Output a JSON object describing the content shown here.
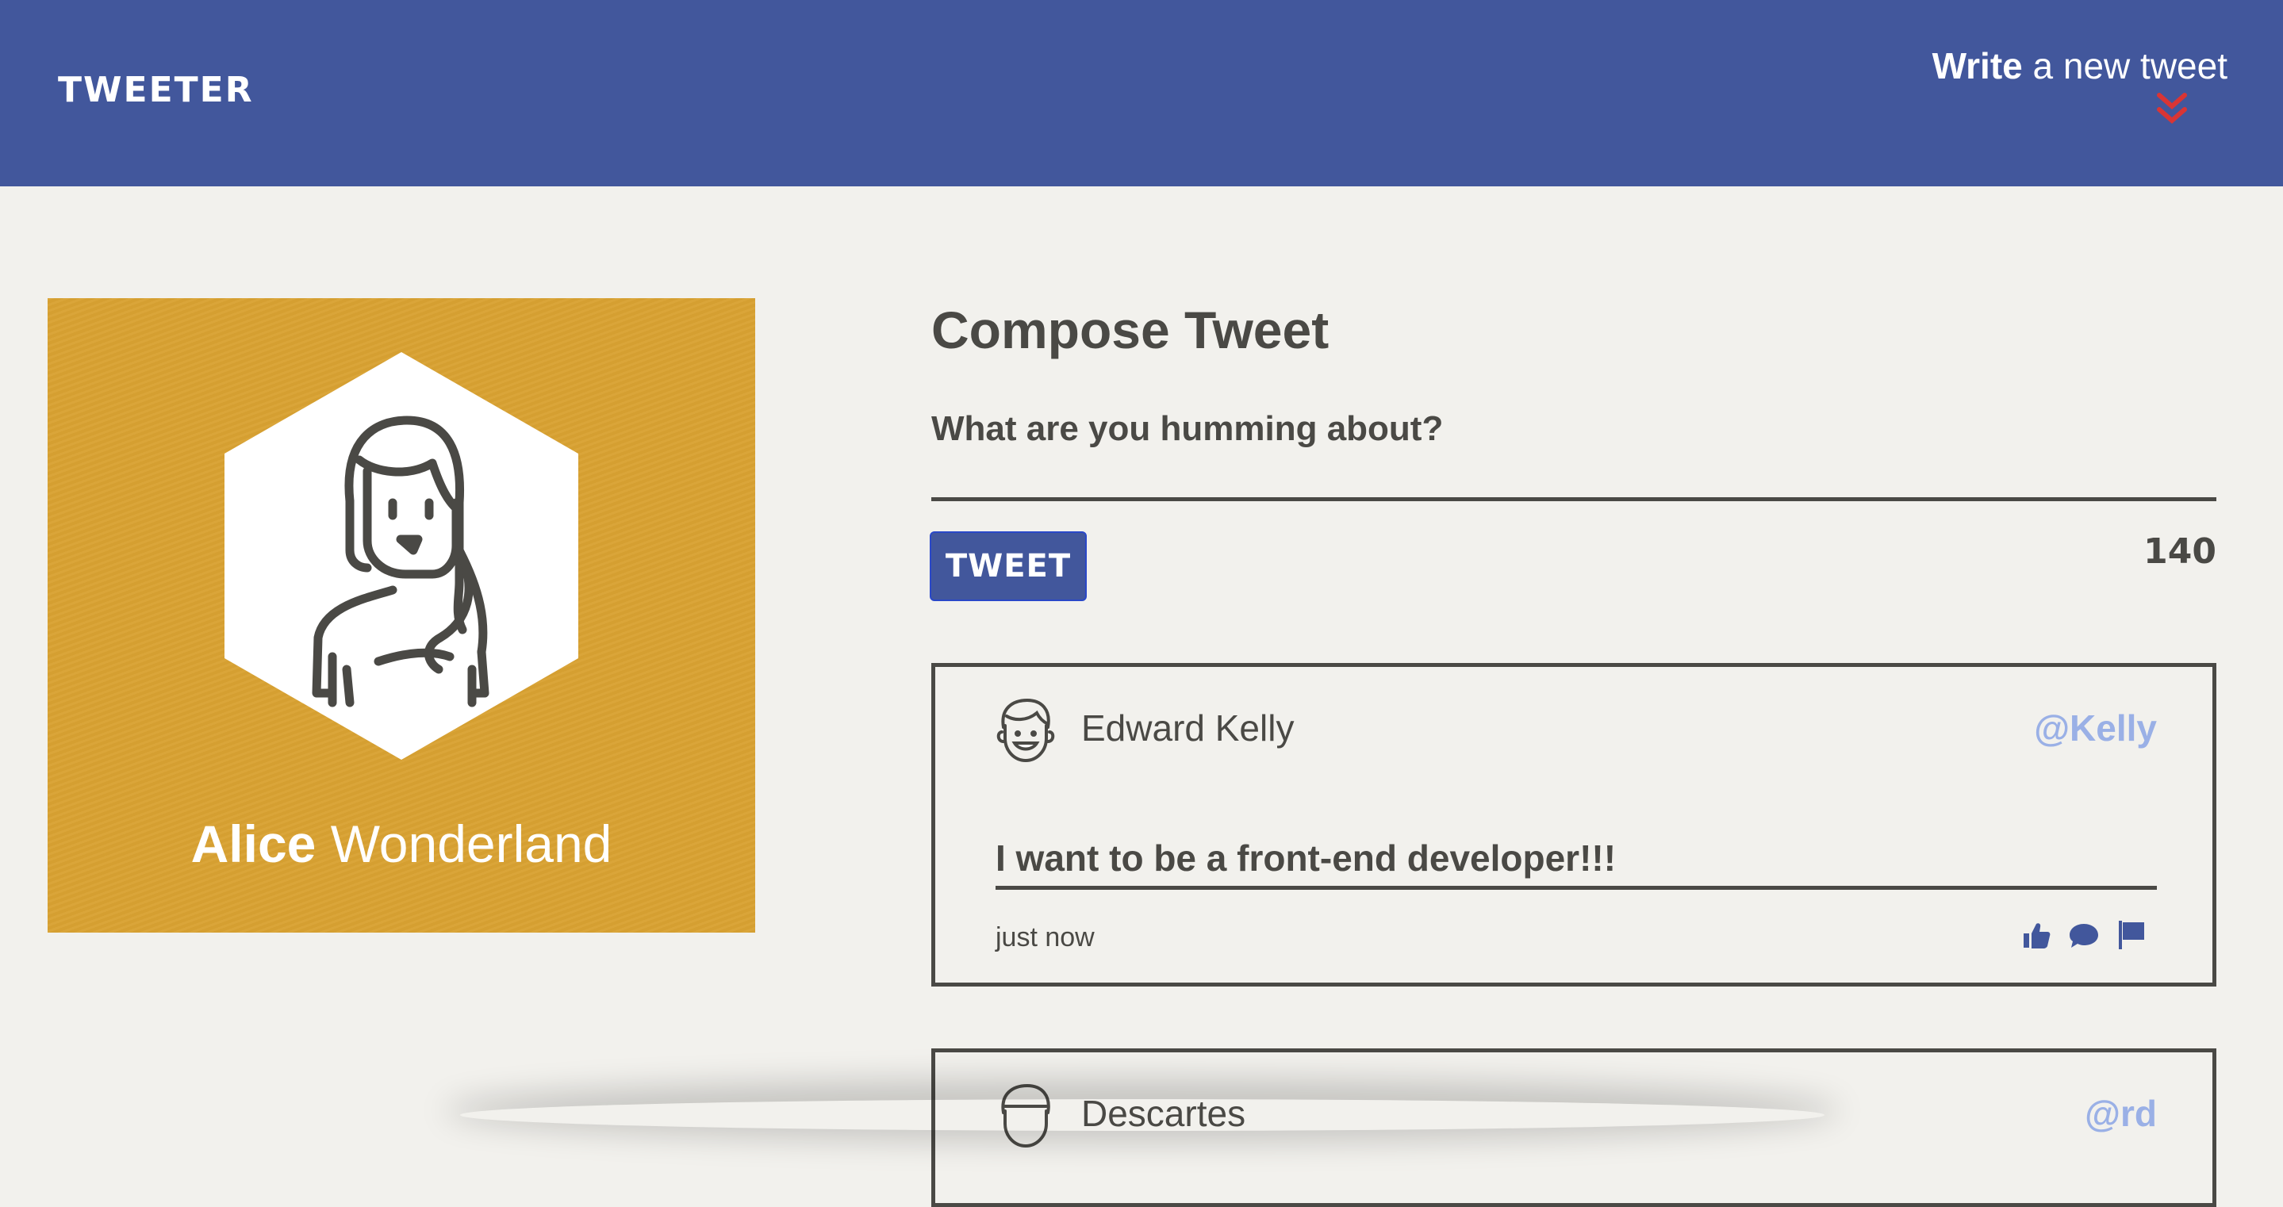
{
  "navbar": {
    "brand": "TWEETER",
    "compose_toggle": {
      "strong": "Write",
      "rest": " a new tweet"
    }
  },
  "profile": {
    "first_name": "Alice",
    "last_name": " Wonderland",
    "avatar_icon": "woman-avatar-icon",
    "background_color": "#d9a232"
  },
  "compose": {
    "title": "Compose Tweet",
    "label": "What are you humming about?",
    "input_value": "",
    "button_label": "TWEET",
    "counter": "140"
  },
  "tweets": [
    {
      "author": "Edward Kelly",
      "handle": "@Kelly",
      "content": "I want to be a front-end developer!!!",
      "time": "just now",
      "actions": [
        "thumbs-up-icon",
        "comment-icon",
        "flag-icon"
      ]
    },
    {
      "author": "Descartes",
      "handle": "@rd"
    }
  ],
  "colors": {
    "nav": "#42579c",
    "accent": "#d93535",
    "handle": "#9ab0e6",
    "text": "#4a4945",
    "background": "#f2f1ed"
  }
}
